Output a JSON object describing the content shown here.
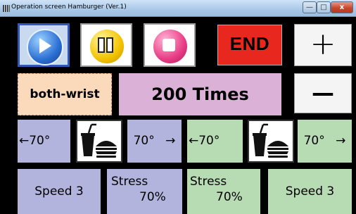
{
  "window": {
    "title": "Operation screen Hamburger (Ver.1)",
    "controls": {
      "minimize": "—",
      "maximize": "□",
      "close": "x"
    }
  },
  "toolbar": {
    "play_icon": "play-icon",
    "pause_icon": "pause-icon",
    "stop_icon": "stop-icon",
    "end_label": "END",
    "plus_label": "+",
    "minus_label": "—"
  },
  "mode": {
    "label": "both-wrist",
    "count_label": "200 Times"
  },
  "left_wrist": {
    "left_angle": "←70°",
    "icon": "hamburger-drink-icon",
    "right_angle": "70° →",
    "speed": "Speed 3",
    "stress_label": "Stress",
    "stress_value": "70%"
  },
  "right_wrist": {
    "left_angle": "←70°",
    "icon": "hamburger-drink-icon",
    "right_angle": "70° →",
    "speed": "Speed 3",
    "stress_label": "Stress",
    "stress_value": "70%"
  },
  "colors": {
    "end": "#e8281f",
    "both_wrist_bg": "#fbd9bb",
    "count_bg": "#dcb1d8",
    "left_group": "#b2b4dd",
    "right_group": "#b7dcb4",
    "play": "#2b6fd3",
    "pause": "#f2c300",
    "stop": "#e83d86"
  }
}
